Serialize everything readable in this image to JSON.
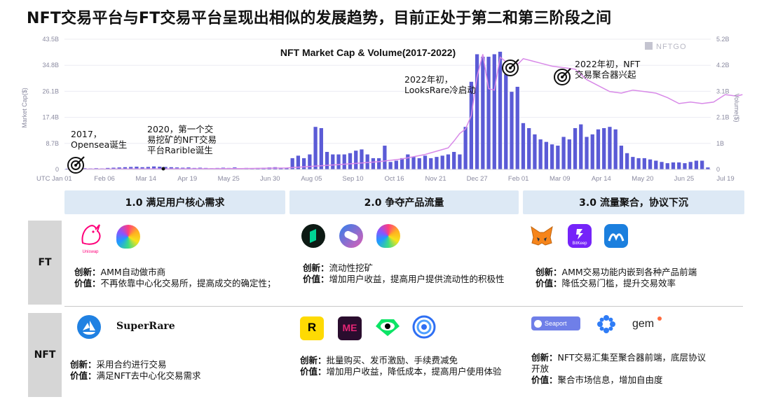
{
  "title": "NFT交易平台与FT交易平台呈现出相似的发展趋势，目前正处于第二和第三阶段之间",
  "chart_data": {
    "type": "bar+line",
    "title": "NFT Market Cap & Volume(2017-2022)",
    "watermark": "NFTGO",
    "ylabel_left": "Market Cap($)",
    "ylabel_right": "Volume($)",
    "x_ticks": [
      "UTC Jan 01",
      "Feb 06",
      "Mar 14",
      "Apr 19",
      "May 25",
      "Jun 30",
      "Aug 05",
      "Sep 10",
      "Oct 16",
      "Nov 21",
      "Dec 27",
      "Feb 01",
      "Mar 09",
      "Apr 14",
      "May 20",
      "Jun 25",
      "Jul 19"
    ],
    "left_ticks": [
      "0",
      "8.7B",
      "17.4B",
      "26.1B",
      "34.8B",
      "43.5B"
    ],
    "right_ticks": [
      "0",
      "1B",
      "2.1B",
      "3.1B",
      "4.2B",
      "5.2B"
    ],
    "ylim_left": [
      0,
      43.5
    ],
    "ylim_right": [
      0,
      5.2
    ],
    "series": [
      {
        "name": "Volume",
        "kind": "bar",
        "color": "#5b5bd6",
        "values": [
          0.03,
          0.03,
          0.03,
          0.05,
          0.04,
          0.05,
          0.04,
          0.06,
          0.07,
          0.08,
          0.09,
          0.1,
          0.11,
          0.09,
          0.1,
          0.12,
          0.11,
          0.1,
          0.09,
          0.08,
          0.07,
          0.08,
          0.06,
          0.07,
          0.06,
          0.05,
          0.06,
          0.07,
          0.06,
          0.08,
          0.05,
          0.06,
          0.05,
          0.06,
          0.07,
          0.08,
          0.09,
          0.06,
          0.05,
          0.45,
          0.55,
          0.45,
          0.6,
          1.7,
          1.65,
          0.7,
          0.6,
          0.6,
          0.6,
          0.65,
          0.75,
          0.8,
          0.6,
          0.45,
          0.45,
          0.95,
          0.3,
          0.35,
          0.45,
          0.6,
          0.5,
          0.45,
          0.55,
          0.45,
          0.5,
          0.55,
          0.6,
          0.7,
          0.6,
          1.7,
          3.5,
          4.6,
          4.5,
          4.5,
          4.6,
          4.7,
          3.8,
          3.1,
          3.3,
          1.85,
          1.65,
          1.4,
          1.2,
          1.1,
          1.0,
          0.95,
          1.3,
          1.2,
          1.65,
          1.8,
          1.3,
          1.4,
          1.6,
          1.65,
          1.7,
          1.6,
          0.95,
          0.65,
          0.5,
          0.45,
          0.45,
          0.4,
          0.35,
          0.3,
          0.25,
          0.28,
          0.28,
          0.25,
          0.3,
          0.35,
          0.35,
          0.08
        ]
      },
      {
        "name": "Market Cap",
        "kind": "line",
        "color": "#d88ae8",
        "points": [
          [
            0,
            0.1
          ],
          [
            10,
            0.15
          ],
          [
            20,
            0.2
          ],
          [
            30,
            0.3
          ],
          [
            38,
            0.5
          ],
          [
            42,
            1.0
          ],
          [
            46,
            1.5
          ],
          [
            50,
            2.0
          ],
          [
            54,
            2.6
          ],
          [
            58,
            3.5
          ],
          [
            62,
            5.0
          ],
          [
            66,
            7.2
          ],
          [
            67,
            9.5
          ],
          [
            68,
            12.0
          ],
          [
            69,
            13.5
          ],
          [
            70,
            18.0
          ],
          [
            71,
            31.0
          ],
          [
            72,
            38.5
          ],
          [
            73,
            27.0
          ],
          [
            74,
            26.5
          ],
          [
            75,
            37.5
          ],
          [
            76,
            36.0
          ],
          [
            77,
            34.0
          ],
          [
            78,
            35.0
          ],
          [
            79,
            37.0
          ],
          [
            80,
            36.5
          ],
          [
            82,
            35.5
          ],
          [
            84,
            34.5
          ],
          [
            86,
            34.0
          ],
          [
            88,
            33.5
          ],
          [
            90,
            30.0
          ],
          [
            92,
            28.0
          ],
          [
            94,
            26.0
          ],
          [
            96,
            25.5
          ],
          [
            98,
            26.5
          ],
          [
            100,
            26.0
          ],
          [
            102,
            25.5
          ],
          [
            104,
            24.0
          ],
          [
            106,
            22.0
          ],
          [
            108,
            22.5
          ],
          [
            110,
            22.0
          ],
          [
            112,
            22.5
          ],
          [
            114,
            25.0
          ],
          [
            116,
            24.5
          ],
          [
            117,
            25.0
          ]
        ]
      }
    ],
    "annotations": [
      {
        "text": "2017，\nOpensea诞生"
      },
      {
        "text": "2020，第一个交\n易挖矿的NFT交易\n平台Rarible诞生"
      },
      {
        "text": "2022年初，\nLooksRare冷启动"
      },
      {
        "text": "2022年初，NFT\n交易聚合器兴起"
      }
    ]
  },
  "phases": [
    {
      "label": "1.0 满足用户核心需求"
    },
    {
      "label": "2.0 争夺产品流量"
    },
    {
      "label": "3.0 流量聚合，协议下沉"
    }
  ],
  "rows": [
    {
      "label": "FT",
      "cells": [
        {
          "logos": [
            {
              "name": "Uniswap",
              "text": "Uniswap"
            },
            {
              "name": "rainbow-logo"
            }
          ],
          "innovation_label": "创新：",
          "innovation": "AMM自动做市商",
          "value_label": "价值：",
          "value": "不再依靠中心化交易所，提高成交的确定性；"
        },
        {
          "logos": [
            {
              "name": "compound-logo"
            },
            {
              "name": "sushi-logo"
            },
            {
              "name": "rainbow-logo"
            }
          ],
          "innovation_label": "创新：",
          "innovation": "流动性挖矿",
          "value_label": "价值：",
          "value": "增加用户收益，提高用户提供流动性的积极性"
        },
        {
          "logos": [
            {
              "name": "metamask-logo"
            },
            {
              "name": "BitKeep",
              "text": "BitKeep"
            },
            {
              "name": "1inch-logo"
            }
          ],
          "innovation_label": "创新：",
          "innovation": "AMM交易功能内嵌到各种产品前端",
          "value_label": "价值：",
          "value": "降低交易门槛，提升交易效率"
        }
      ]
    },
    {
      "label": "NFT",
      "cells": [
        {
          "logos": [
            {
              "name": "opensea-logo"
            },
            {
              "name": "SuperRare",
              "text": "SuperRare"
            }
          ],
          "innovation_label": "创新：",
          "innovation": "采用合约进行交易",
          "value_label": "价值：",
          "value": "满足NFT去中心化交易需求"
        },
        {
          "logos": [
            {
              "name": "rarible-logo",
              "text": "R"
            },
            {
              "name": "magiceden-logo",
              "text": "ME"
            },
            {
              "name": "looksrare-logo"
            },
            {
              "name": "x2y2-logo"
            }
          ],
          "innovation_label": "创新：",
          "innovation": "批量购买、发币激励、手续费减免",
          "value_label": "价值：",
          "value": "增加用户收益，降低成本，提高用户使用体验"
        },
        {
          "logos": [
            {
              "name": "Seaport",
              "text": "Seaport"
            },
            {
              "name": "genie-logo"
            },
            {
              "name": "gem",
              "text": "gem"
            }
          ],
          "innovation_label": "创新：",
          "innovation": "NFT交易汇集至聚合器前端，底层协议开放",
          "value_label": "价值：",
          "value": "聚合市场信息，增加自由度"
        }
      ]
    }
  ]
}
